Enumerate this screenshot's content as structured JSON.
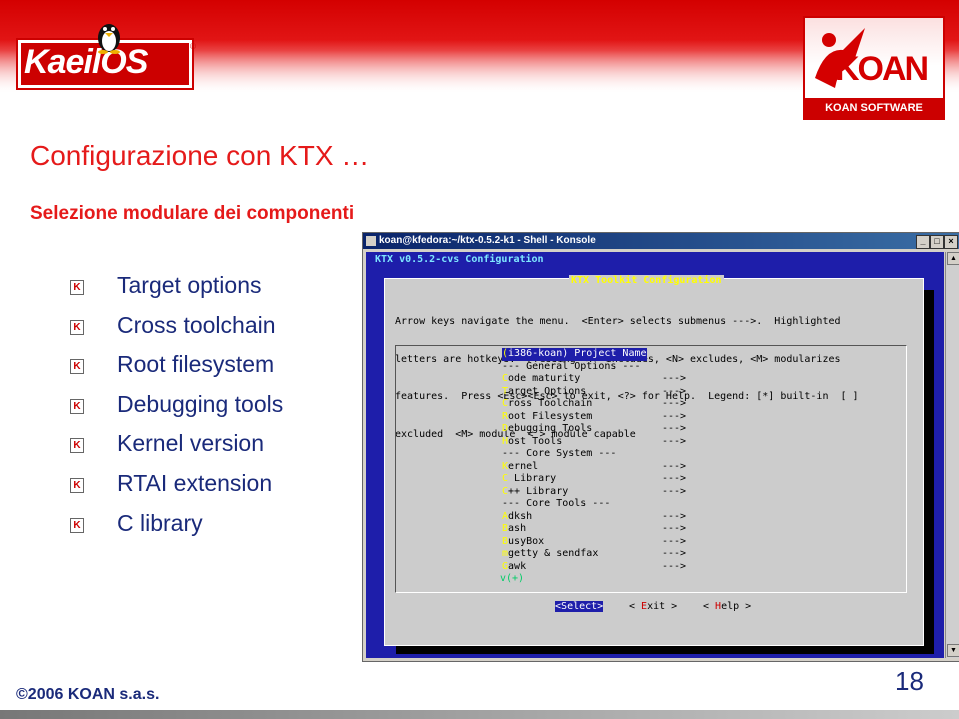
{
  "brand": {
    "left_logo": "KaeilOS",
    "left_logo_reg": "®",
    "right_logo": "KOAN",
    "right_logo_caption": "KOAN SOFTWARE"
  },
  "slide": {
    "title": "Configurazione con KTX …",
    "subtitle": "Selezione modulare dei componenti",
    "bullet_marker": "K",
    "bullets": [
      "Target options",
      "Cross toolchain",
      "Root filesystem",
      "Debugging tools",
      "Kernel version",
      "RTAI extension",
      "C library"
    ],
    "footer": "©2006 KOAN s.a.s.",
    "page_number": "18"
  },
  "window": {
    "title": "koan@kfedora:~/ktx-0.5.2-k1 - Shell - Konsole",
    "buttons": [
      "_",
      "□",
      "×"
    ],
    "header": "KTX v0.5.2-cvs Configuration",
    "dialog_title": "KTX Toolkit Configuration",
    "help_text": [
      "Arrow keys navigate the menu.  <Enter> selects submenus --->.  Highlighted",
      "letters are hotkeys.  Pressing <Y> includes, <N> excludes, <M> modularizes",
      "features.  Press <Esc><Esc> to exit, <?> for Help.  Legend: [*] built-in  [ ]",
      "excluded  <M> module  < > module capable"
    ],
    "menu_items": [
      {
        "hk": "(",
        "text": "i386-koan) Project Name",
        "arrow": ""
      },
      {
        "hk": "",
        "text": "--- General Options ---",
        "arrow": ""
      },
      {
        "hk": "C",
        "text": "ode maturity",
        "arrow": "--->"
      },
      {
        "hk": "T",
        "text": "arget Options",
        "arrow": "--->"
      },
      {
        "hk": "C",
        "text": "ross Toolchain",
        "arrow": "--->"
      },
      {
        "hk": "R",
        "text": "oot Filesystem",
        "arrow": "--->"
      },
      {
        "hk": "D",
        "text": "ebugging Tools",
        "arrow": "--->"
      },
      {
        "hk": "H",
        "text": "ost Tools",
        "arrow": "--->"
      },
      {
        "hk": "",
        "text": "--- Core System ---",
        "arrow": ""
      },
      {
        "hk": "K",
        "text": "ernel",
        "arrow": "--->"
      },
      {
        "hk": "C",
        "text": " Library",
        "arrow": "--->"
      },
      {
        "hk": "C",
        "text": "++ Library",
        "arrow": "--->"
      },
      {
        "hk": "",
        "text": "--- Core Tools ---",
        "arrow": ""
      },
      {
        "hk": "A",
        "text": "dksh",
        "arrow": "--->"
      },
      {
        "hk": "B",
        "text": "ash",
        "arrow": "--->"
      },
      {
        "hk": "B",
        "text": "usyBox",
        "arrow": "--->"
      },
      {
        "hk": "m",
        "text": "getty & sendfax",
        "arrow": "--->"
      },
      {
        "hk": "G",
        "text": "awk",
        "arrow": "--->"
      }
    ],
    "more_indicator": "v(+)",
    "btn_select": {
      "lt": "<",
      "hk": "S",
      "rest": "elect>"
    },
    "btn_exit": {
      "lt": "< ",
      "hk": "E",
      "rest": "xit >"
    },
    "btn_help": {
      "lt": "< ",
      "hk": "H",
      "rest": "elp >"
    }
  }
}
